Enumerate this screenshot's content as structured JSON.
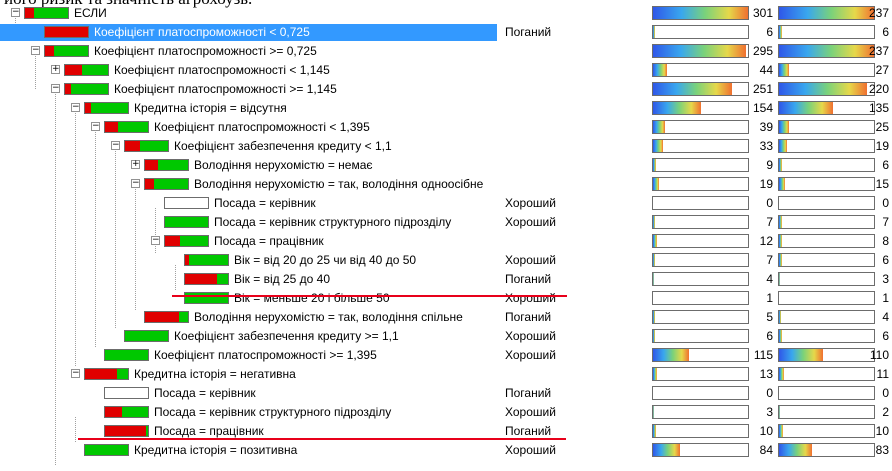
{
  "caption": "його ризик та значність агрохоузь.",
  "rows": [
    {
      "label": "ЕСЛИ",
      "cls": "",
      "n1": "301",
      "n2": "237",
      "f1": 1.0,
      "f2": 1.0
    },
    {
      "label": "Коефіцієнт платоспроможності < 0,725",
      "cls": "Поганий",
      "n1": "6",
      "n2": "6",
      "f1": 0.02,
      "f2": 0.03
    },
    {
      "label": "Коефіцієнт платоспроможності >= 0,725",
      "cls": "",
      "n1": "295",
      "n2": "237",
      "f1": 0.98,
      "f2": 1.0
    },
    {
      "label": "Коефіцієнт платоспроможності < 1,145",
      "cls": "",
      "n1": "44",
      "n2": "27",
      "f1": 0.15,
      "f2": 0.11
    },
    {
      "label": "Коефіцієнт платоспроможності >= 1,145",
      "cls": "",
      "n1": "251",
      "n2": "220",
      "f1": 0.83,
      "f2": 0.93
    },
    {
      "label": "Кредитна історія = відсутня",
      "cls": "",
      "n1": "154",
      "n2": "135",
      "f1": 0.5,
      "f2": 0.57
    },
    {
      "label": "Коефіцієнт платоспроможності < 1,395",
      "cls": "",
      "n1": "39",
      "n2": "25",
      "f1": 0.13,
      "f2": 0.11
    },
    {
      "label": "Коефіцієнт забезпечення кредиту < 1,1",
      "cls": "",
      "n1": "33",
      "n2": "19",
      "f1": 0.11,
      "f2": 0.08
    },
    {
      "label": "Володіння нерухомістю = немає",
      "cls": "",
      "n1": "9",
      "n2": "6",
      "f1": 0.03,
      "f2": 0.03
    },
    {
      "label": "Володіння нерухомістю = так, володіння одноосібне",
      "cls": "",
      "n1": "19",
      "n2": "15",
      "f1": 0.06,
      "f2": 0.06
    },
    {
      "label": "Посада = керівник",
      "cls": "Хороший",
      "n1": "0",
      "n2": "0",
      "f1": 0.0,
      "f2": 0.0
    },
    {
      "label": "Посада = керівник структурного підрозділу",
      "cls": "Хороший",
      "n1": "7",
      "n2": "7",
      "f1": 0.02,
      "f2": 0.03
    },
    {
      "label": "Посада = працівник",
      "cls": "",
      "n1": "12",
      "n2": "8",
      "f1": 0.04,
      "f2": 0.03
    },
    {
      "label": "Вік = від 20 до 25 чи від 40 до 50",
      "cls": "Хороший",
      "n1": "7",
      "n2": "6",
      "f1": 0.02,
      "f2": 0.03
    },
    {
      "label": "Вік = від 25 до 40",
      "cls": "Поганий",
      "n1": "4",
      "n2": "3",
      "f1": 0.01,
      "f2": 0.01
    },
    {
      "label": "Вік = меньше 20 і більше 50",
      "cls": "Хороший",
      "n1": "1",
      "n2": "1",
      "f1": 0.005,
      "f2": 0.005
    },
    {
      "label": "Володіння нерухомістю = так, володіння спільне",
      "cls": "Поганий",
      "n1": "5",
      "n2": "4",
      "f1": 0.02,
      "f2": 0.02
    },
    {
      "label": "Коефіцієнт забезпечення кредиту >= 1,1",
      "cls": "Хороший",
      "n1": "6",
      "n2": "6",
      "f1": 0.02,
      "f2": 0.03
    },
    {
      "label": "Коефіцієнт платоспроможності >= 1,395",
      "cls": "Хороший",
      "n1": "115",
      "n2": "110",
      "f1": 0.38,
      "f2": 0.46
    },
    {
      "label": "Кредитна історія = негативна",
      "cls": "",
      "n1": "13",
      "n2": "11",
      "f1": 0.04,
      "f2": 0.05
    },
    {
      "label": "Посада = керівник",
      "cls": "Поганий",
      "n1": "0",
      "n2": "0",
      "f1": 0.0,
      "f2": 0.0
    },
    {
      "label": "Посада = керівник структурного підрозділу",
      "cls": "Хороший",
      "n1": "3",
      "n2": "2",
      "f1": 0.01,
      "f2": 0.01
    },
    {
      "label": "Посада = працівник",
      "cls": "Поганий",
      "n1": "10",
      "n2": "10",
      "f1": 0.03,
      "f2": 0.04
    },
    {
      "label": "Кредитна історія = позитивна",
      "cls": "Хороший",
      "n1": "84",
      "n2": "83",
      "f1": 0.28,
      "f2": 0.35
    }
  ],
  "colors": {
    "selection": "#3399ff",
    "bad": "#e00000",
    "good": "#00c800",
    "annotation": "#e8001a"
  }
}
